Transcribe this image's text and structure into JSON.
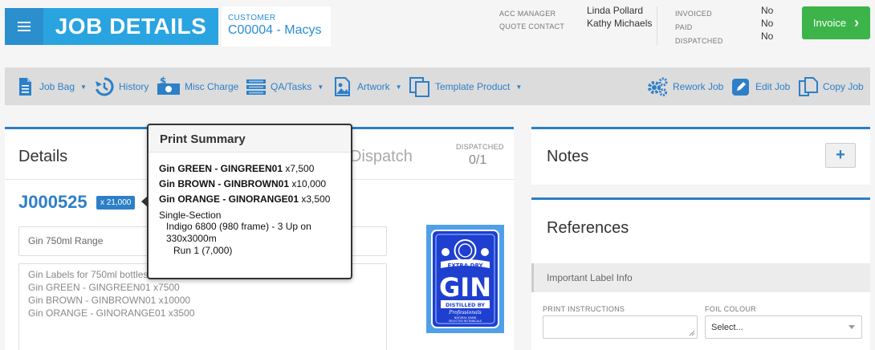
{
  "header": {
    "title": "JOB DETAILS",
    "customer_label": "CUSTOMER",
    "customer_value": "C00004 - Macys",
    "acc_manager_label": "ACC MANAGER",
    "quote_contact_label": "QUOTE CONTACT",
    "acc_manager": "Linda Pollard",
    "quote_contact": "Kathy Michaels",
    "invoiced_label": "INVOICED",
    "paid_label": "PAID",
    "dispatched_label": "DISPATCHED",
    "invoiced": "No",
    "paid": "No",
    "dispatched": "No",
    "invoice_button": "Invoice"
  },
  "toolbar": {
    "job_bag": "Job Bag",
    "history": "History",
    "misc_charge": "Misc Charge",
    "qa_tasks": "QA/Tasks",
    "artwork": "Artwork",
    "template_product": "Template Product",
    "rework_job": "Rework Job",
    "edit_job": "Edit Job",
    "copy_job": "Copy Job"
  },
  "details": {
    "title": "Details",
    "dispatch_tab": "Dispatch",
    "dispatched_label": "DISPATCHED",
    "dispatched_value": "0/1",
    "job_number": "J000525",
    "quantity_badge": "x 21,000",
    "range_name": "Gin 750ml Range",
    "description_lines": [
      "Gin Labels for 750ml bottles",
      "Gin GREEN - GINGREEN01 x7500",
      "Gin BROWN - GINBROWN01 x10000",
      "Gin ORANGE - GINORANGE01 x3500"
    ]
  },
  "gin_label": {
    "extra_dry": "EXTRA DRY",
    "gin": "GIN",
    "distilled": "DISTILLED BY",
    "professionals": "Professionals",
    "natural": "NATURAL HAND",
    "selected": "SELECTED BOTANICALS"
  },
  "notes": {
    "title": "Notes",
    "add": "+"
  },
  "references": {
    "title": "References",
    "important_label": "Important Label Info",
    "print_instructions_label": "PRINT INSTRUCTIONS",
    "foil_colour_label": "FOIL COLOUR",
    "foil_colour_value": "Select..."
  },
  "popover": {
    "title": "Print Summary",
    "items": [
      {
        "name": "Gin GREEN - GINGREEN01",
        "qty": "x7,500"
      },
      {
        "name": "Gin BROWN - GINBROWN01",
        "qty": "x10,000"
      },
      {
        "name": "Gin ORANGE - GINORANGE01",
        "qty": "x3,500"
      }
    ],
    "section": "Single-Section",
    "press_line1": "Indigo 6800 (980 frame) - 3 Up on",
    "press_line2": "330x3000m",
    "run": "Run 1 (7,000)"
  },
  "colors": {
    "primary_blue": "#2d7fc7",
    "title_blue": "#2aa4e0",
    "invoice_green": "#3cb44a"
  }
}
